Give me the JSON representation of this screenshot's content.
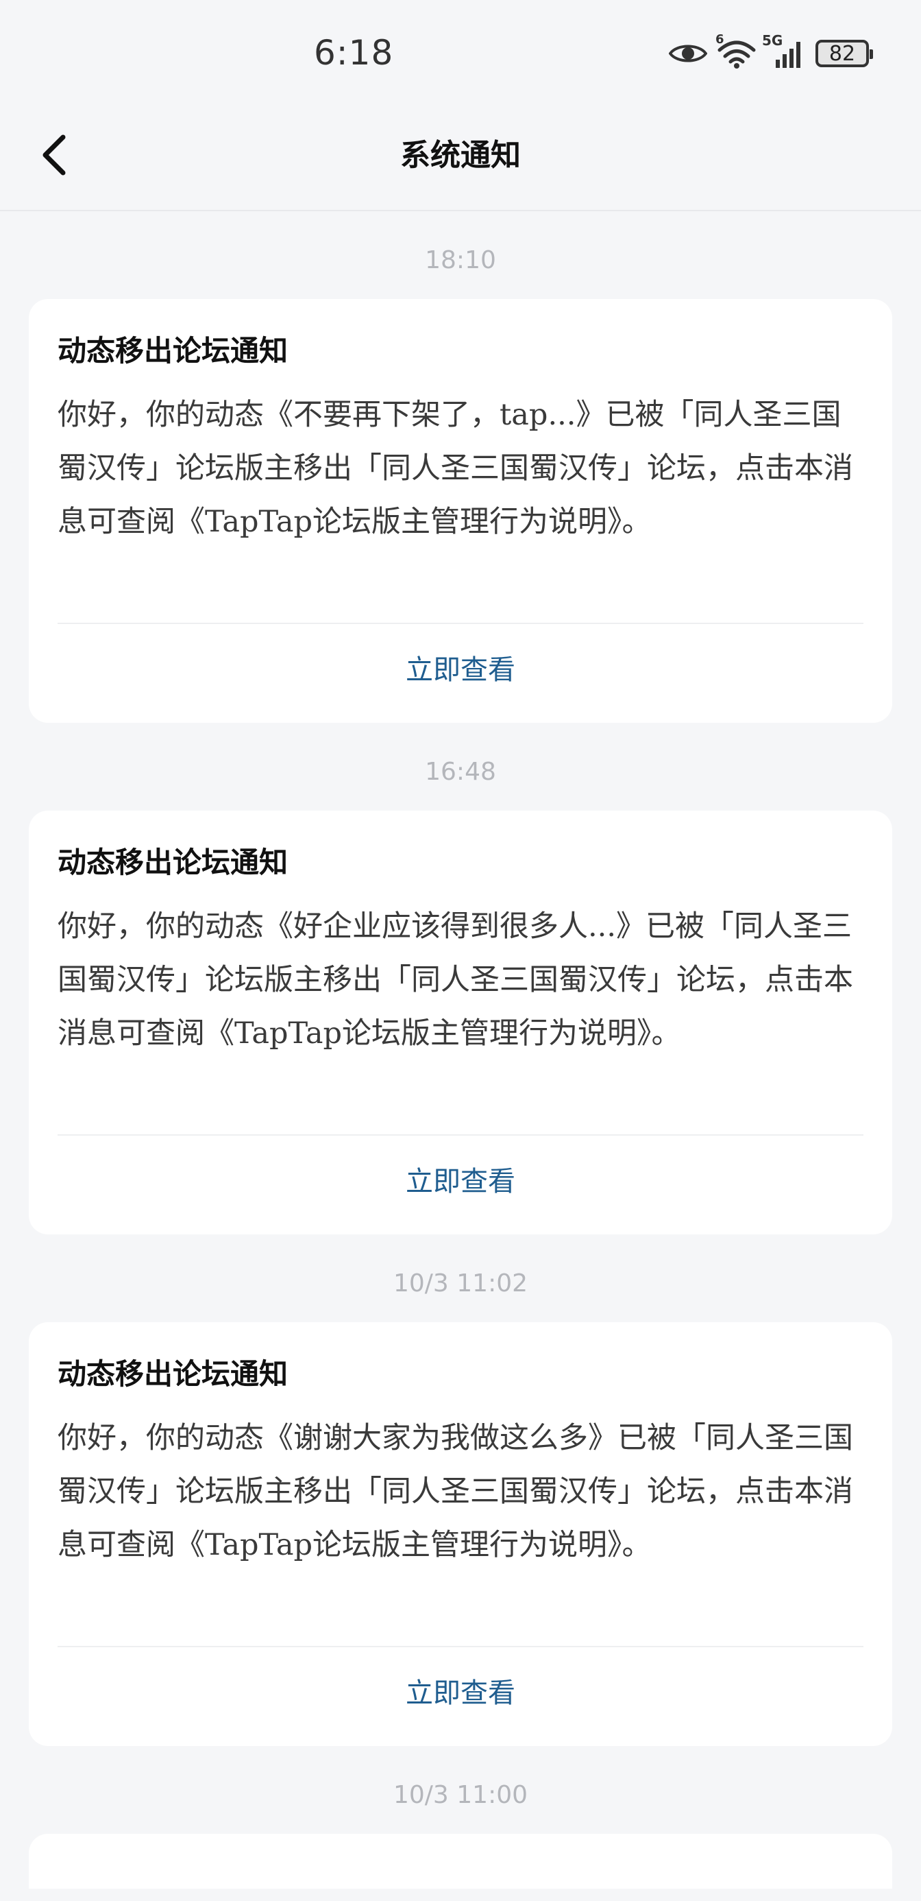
{
  "status_bar": {
    "time": "6:18",
    "network": "5G",
    "wifi_badge": "6",
    "battery": "82"
  },
  "header": {
    "title": "系统通知"
  },
  "notifications": [
    {
      "time": "18:10",
      "title": "动态移出论坛通知",
      "body": "你好，你的动态《不要再下架了，tap...》已被「同人圣三国蜀汉传」论坛版主移出「同人圣三国蜀汉传」论坛，点击本消息可查阅《TapTap论坛版主管理行为说明》。",
      "action": "立即查看"
    },
    {
      "time": "16:48",
      "title": "动态移出论坛通知",
      "body": "你好，你的动态《好企业应该得到很多人...》已被「同人圣三国蜀汉传」论坛版主移出「同人圣三国蜀汉传」论坛，点击本消息可查阅《TapTap论坛版主管理行为说明》。",
      "action": "立即查看"
    },
    {
      "time": "10/3  11:02",
      "title": "动态移出论坛通知",
      "body": "你好，你的动态《谢谢大家为我做这么多》已被「同人圣三国蜀汉传」论坛版主移出「同人圣三国蜀汉传」论坛，点击本消息可查阅《TapTap论坛版主管理行为说明》。",
      "action": "立即查看"
    }
  ],
  "next_time": "10/3  11:00",
  "colors": {
    "background": "#f5f6f8",
    "card": "#ffffff",
    "link": "#1f5d8f",
    "timestamp": "#b4b6bb"
  },
  "icons": {
    "back": "chevron-left-icon",
    "eye": "eye-icon",
    "wifi": "wifi-icon",
    "signal": "signal-icon",
    "battery": "battery-icon"
  }
}
